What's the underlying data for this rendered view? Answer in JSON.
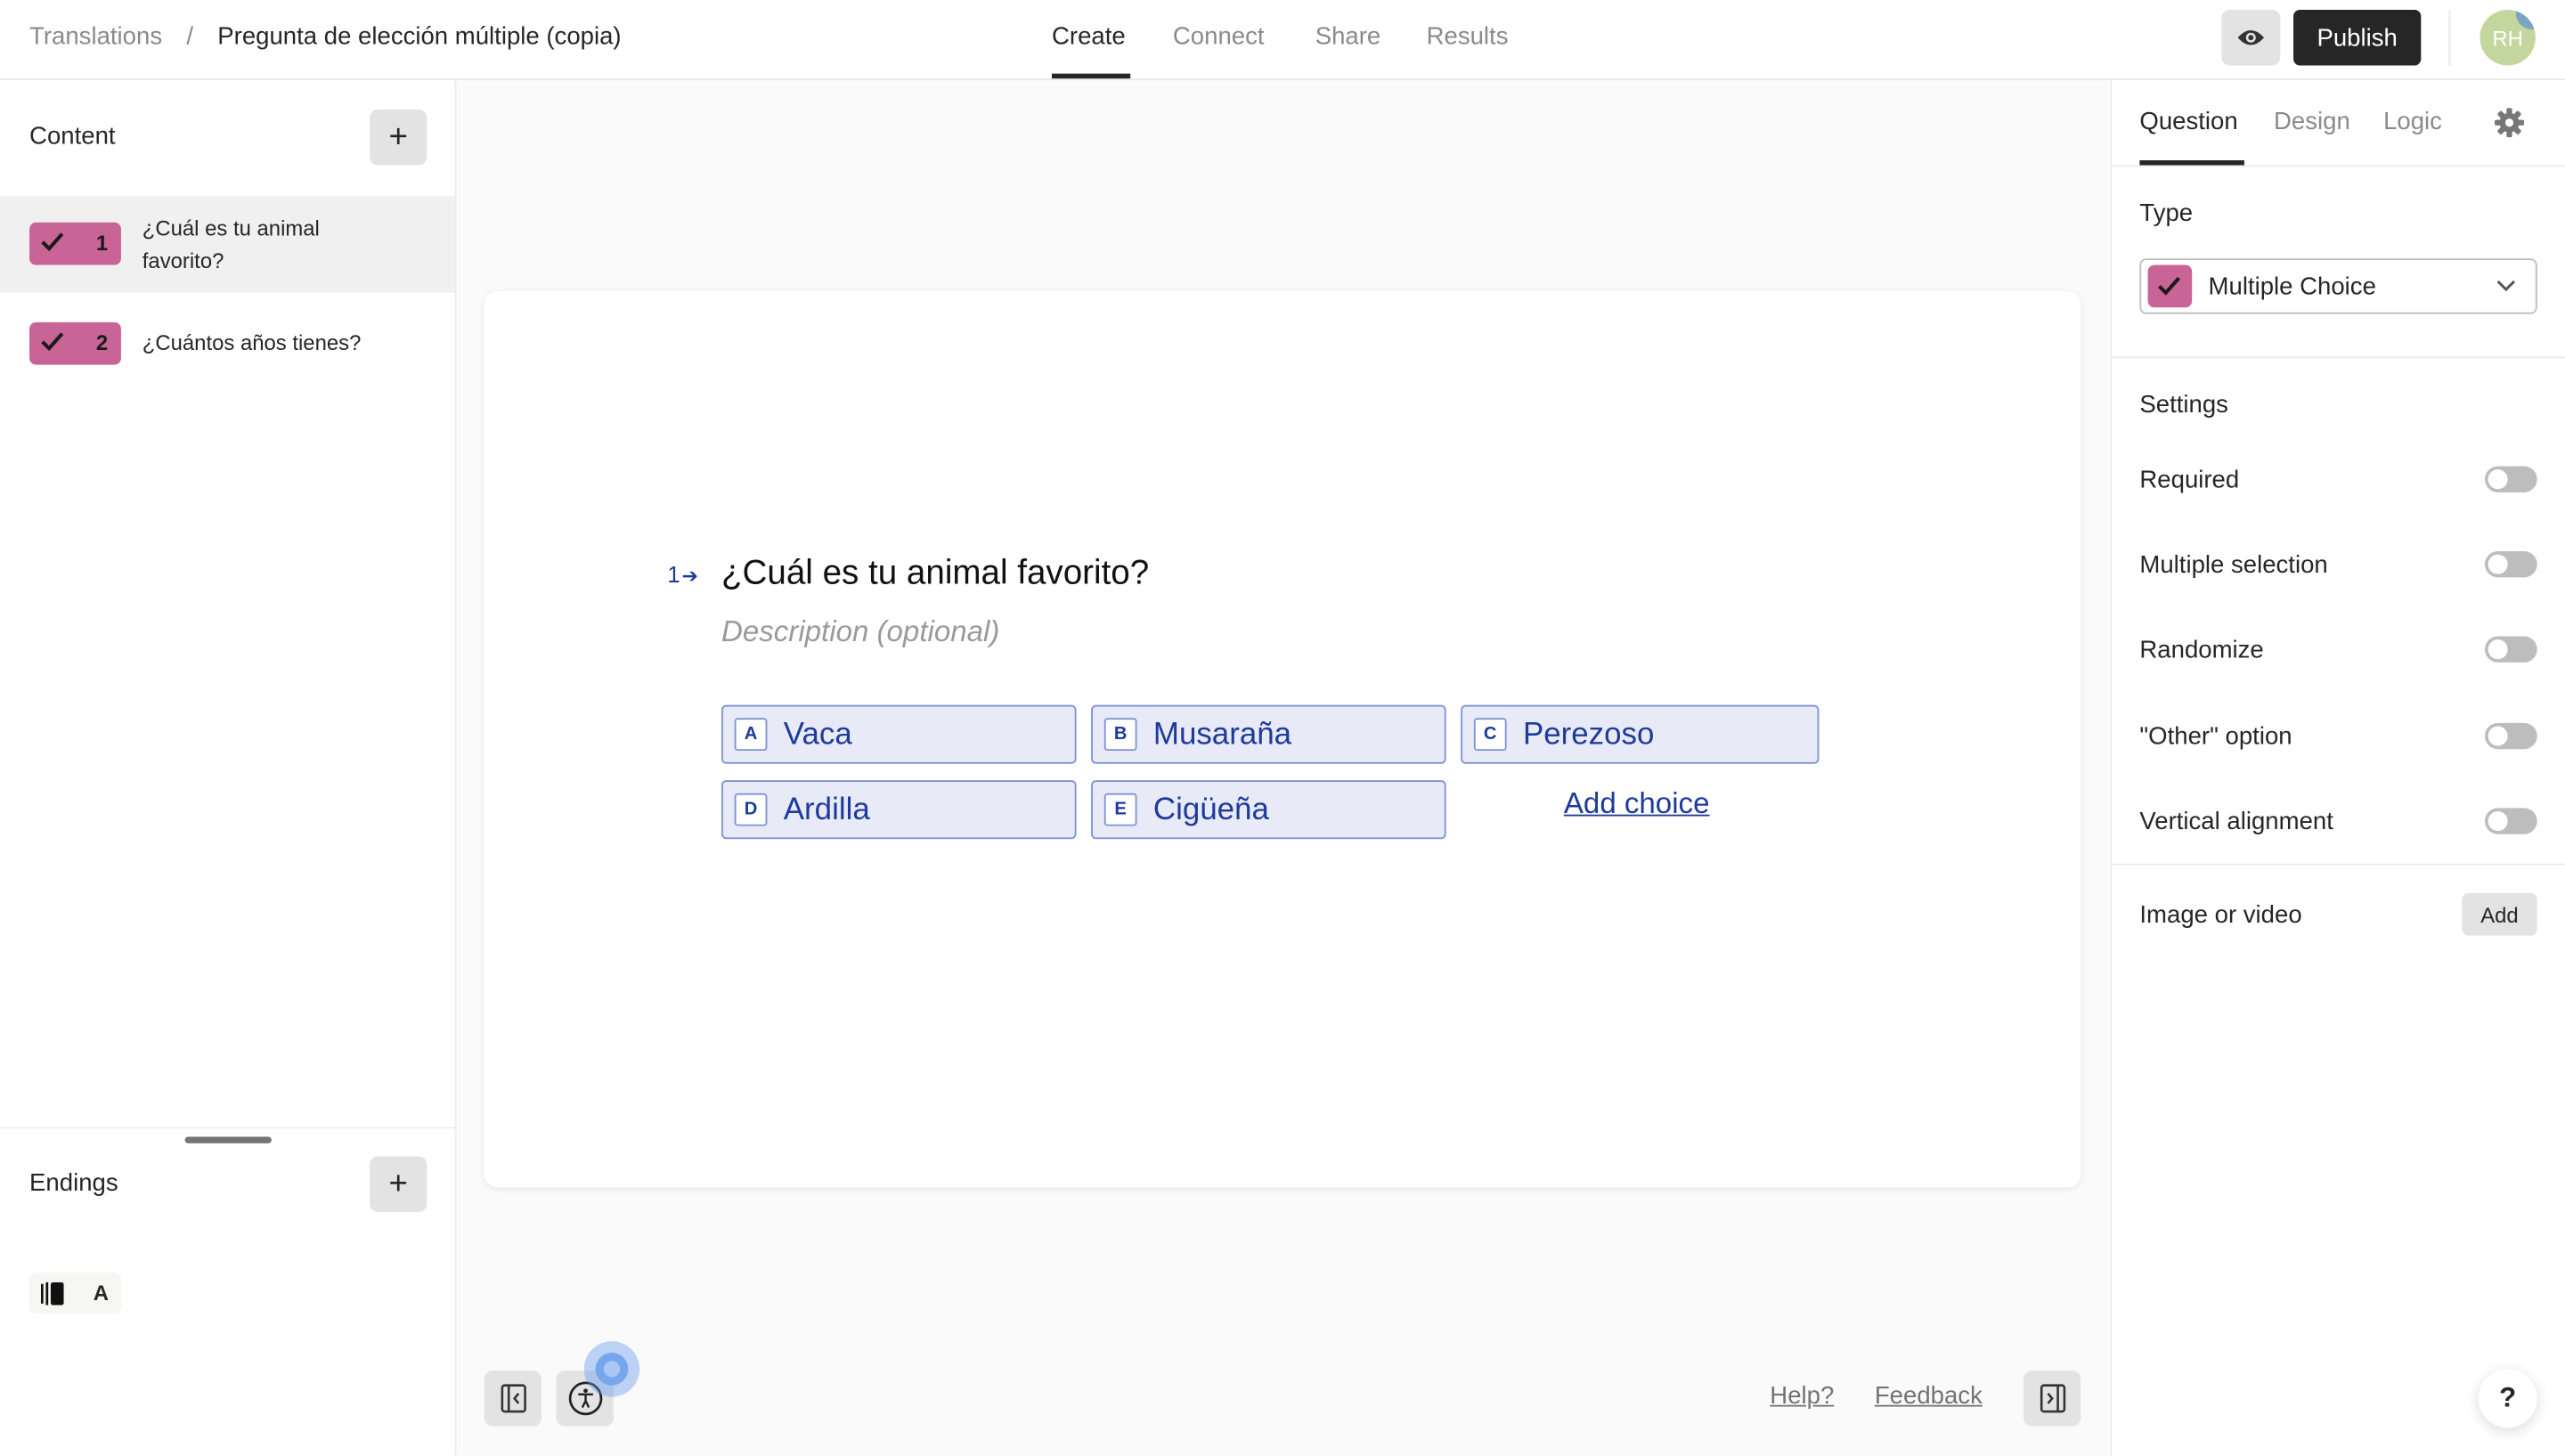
{
  "header": {
    "breadcrumb": [
      "Translations",
      "Pregunta de elección múltiple (copia)"
    ],
    "separator": "/",
    "nav_tabs": [
      {
        "label": "Create",
        "active": true
      },
      {
        "label": "Connect",
        "active": false
      },
      {
        "label": "Share",
        "active": false
      },
      {
        "label": "Results",
        "active": false
      }
    ],
    "preview_icon": "eye-icon",
    "publish_label": "Publish",
    "avatar_initials": "RH"
  },
  "sidebar": {
    "content_title": "Content",
    "questions": [
      {
        "number": "1",
        "title": "¿Cuál es tu animal favorito?",
        "selected": true
      },
      {
        "number": "2",
        "title": "¿Cuántos años tienes?",
        "selected": false
      }
    ],
    "endings_title": "Endings",
    "endings": [
      {
        "label": "A"
      }
    ]
  },
  "editor": {
    "question_number": "1",
    "question_title": "¿Cuál es tu animal favorito?",
    "description_placeholder": "Description (optional)",
    "choices": [
      {
        "key": "A",
        "label": "Vaca"
      },
      {
        "key": "B",
        "label": "Musaraña"
      },
      {
        "key": "C",
        "label": "Perezoso"
      },
      {
        "key": "D",
        "label": "Ardilla"
      },
      {
        "key": "E",
        "label": "Cigüeña"
      }
    ],
    "add_choice_label": "Add choice",
    "help_link": "Help?",
    "feedback_link": "Feedback"
  },
  "panel": {
    "tabs": [
      {
        "label": "Question",
        "active": true
      },
      {
        "label": "Design",
        "active": false
      },
      {
        "label": "Logic",
        "active": false
      }
    ],
    "type_label": "Type",
    "type_value": "Multiple Choice",
    "settings_label": "Settings",
    "settings": [
      {
        "label": "Required",
        "on": false
      },
      {
        "label": "Multiple selection",
        "on": false
      },
      {
        "label": "Randomize",
        "on": false
      },
      {
        "label": "\"Other\" option",
        "on": false
      },
      {
        "label": "Vertical alignment",
        "on": false
      }
    ],
    "media_label": "Image or video",
    "media_add_label": "Add",
    "help_bubble": "?"
  },
  "colors": {
    "accent": "#c86496",
    "choice_bg": "#e8ebf7",
    "choice_border": "#7d93d3",
    "choice_text": "#1e3a9c",
    "publish_bg": "#262627"
  }
}
